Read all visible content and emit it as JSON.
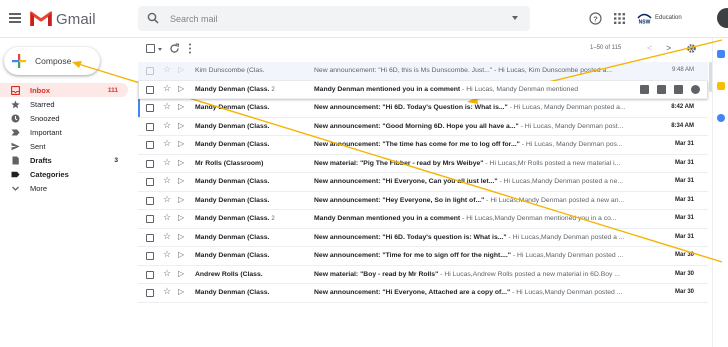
{
  "app": {
    "name": "Gmail"
  },
  "search": {
    "placeholder": "Search mail"
  },
  "org": {
    "logo_text": "NSW",
    "label": "Education"
  },
  "compose": {
    "label": "Compose"
  },
  "sidebar": {
    "items": [
      {
        "label": "Inbox",
        "count": "111",
        "icon": "inbox-icon"
      },
      {
        "label": "Starred",
        "count": "",
        "icon": "star-icon"
      },
      {
        "label": "Snoozed",
        "count": "",
        "icon": "clock-icon"
      },
      {
        "label": "Important",
        "count": "",
        "icon": "important-icon"
      },
      {
        "label": "Sent",
        "count": "",
        "icon": "send-icon"
      },
      {
        "label": "Drafts",
        "count": "3",
        "icon": "draft-icon"
      },
      {
        "label": "Categories",
        "count": "",
        "icon": "label-icon"
      },
      {
        "label": "More",
        "count": "",
        "icon": "chevron-down-icon"
      }
    ]
  },
  "toolbar": {
    "range": "1–50 of 115",
    "prev": "<",
    "next": ">"
  },
  "emails": [
    {
      "sender": "Kim Dunscombe (Clas.",
      "count": "",
      "subject": "New announcement: \"Hi 6D, this is Ms Dunscombe. Just...\"",
      "snippet": " - Hi Lucas, Kim Dunscombe posted a...",
      "date": "9:48 AM",
      "unread": false
    },
    {
      "sender": "Mandy Denman (Class.",
      "count": "2",
      "subject": "Mandy Denman mentioned you in a comment",
      "snippet": " - Hi Lucas, Mandy Denman mentioned",
      "date": "",
      "unread": true
    },
    {
      "sender": "Mandy Denman (Class.",
      "count": "",
      "subject": "New announcement: \"Hi 6D. Today's Question is: What is...\"",
      "snippet": " - Hi Lucas, Mandy Denman posted a...",
      "date": "8:42 AM",
      "unread": true
    },
    {
      "sender": "Mandy Denman (Class.",
      "count": "",
      "subject": "New announcement: \"Good Morning 6D. Hope you all have a...\"",
      "snippet": " - Hi Lucas, Mandy Denman post...",
      "date": "8:34 AM",
      "unread": true
    },
    {
      "sender": "Mandy Denman (Class.",
      "count": "",
      "subject": "New announcement: \"The time has come for me to log off for...\"",
      "snippet": " - Hi Lucas, Mandy Denman pos...",
      "date": "Mar 31",
      "unread": true
    },
    {
      "sender": "Mr Rolls (Classroom)",
      "count": "",
      "subject": "New material: \"Pig The Fibber - read by Mrs Weibye\"",
      "snippet": " - Hi Lucas,Mr Rolls posted a new material i...",
      "date": "Mar 31",
      "unread": true
    },
    {
      "sender": "Mandy Denman (Class.",
      "count": "",
      "subject": "New announcement: \"Hi Everyone, Can you all just let...\"",
      "snippet": " - Hi Lucas,Mandy Denman posted a ne...",
      "date": "Mar 31",
      "unread": true
    },
    {
      "sender": "Mandy Denman (Class.",
      "count": "",
      "subject": "New announcement: \"Hey Everyone, So in light of...\"",
      "snippet": " - Hi Lucas,Mandy Denman posted a new an...",
      "date": "Mar 31",
      "unread": true
    },
    {
      "sender": "Mandy Denman (Class.",
      "count": "2",
      "subject": "Mandy Denman mentioned you in a comment",
      "snippet": " - Hi Lucas,Mandy Denman mentioned you in a co...",
      "date": "Mar 31",
      "unread": true
    },
    {
      "sender": "Mandy Denman (Class.",
      "count": "",
      "subject": "New announcement: \"Hi 6D. Today's question is: What is...\"",
      "snippet": " - Hi Lucas,Mandy Denman posted a ...",
      "date": "Mar 31",
      "unread": true
    },
    {
      "sender": "Mandy Denman (Class.",
      "count": "",
      "subject": "New announcement: \"Time for me to sign off for the night....\"",
      "snippet": " - Hi Lucas,Mandy Denman posted ...",
      "date": "Mar 30",
      "unread": true
    },
    {
      "sender": "Andrew Rolls (Class.",
      "count": "",
      "subject": "New material: \"Boy - read by Mr Rolls\"",
      "snippet": " - Hi Lucas,Andrew Rolls posted a new material in 6D.Boy ...",
      "date": "Mar 30",
      "unread": true
    },
    {
      "sender": "Mandy Denman (Class.",
      "count": "",
      "subject": "New announcement: \"Hi Everyone, Attached are a copy of...\"",
      "snippet": " - Hi Lucas,Mandy Denman posted ...",
      "date": "Mar 30",
      "unread": true
    }
  ],
  "colors": {
    "accent_red": "#d93025",
    "annotation_line": "#f4b400"
  }
}
